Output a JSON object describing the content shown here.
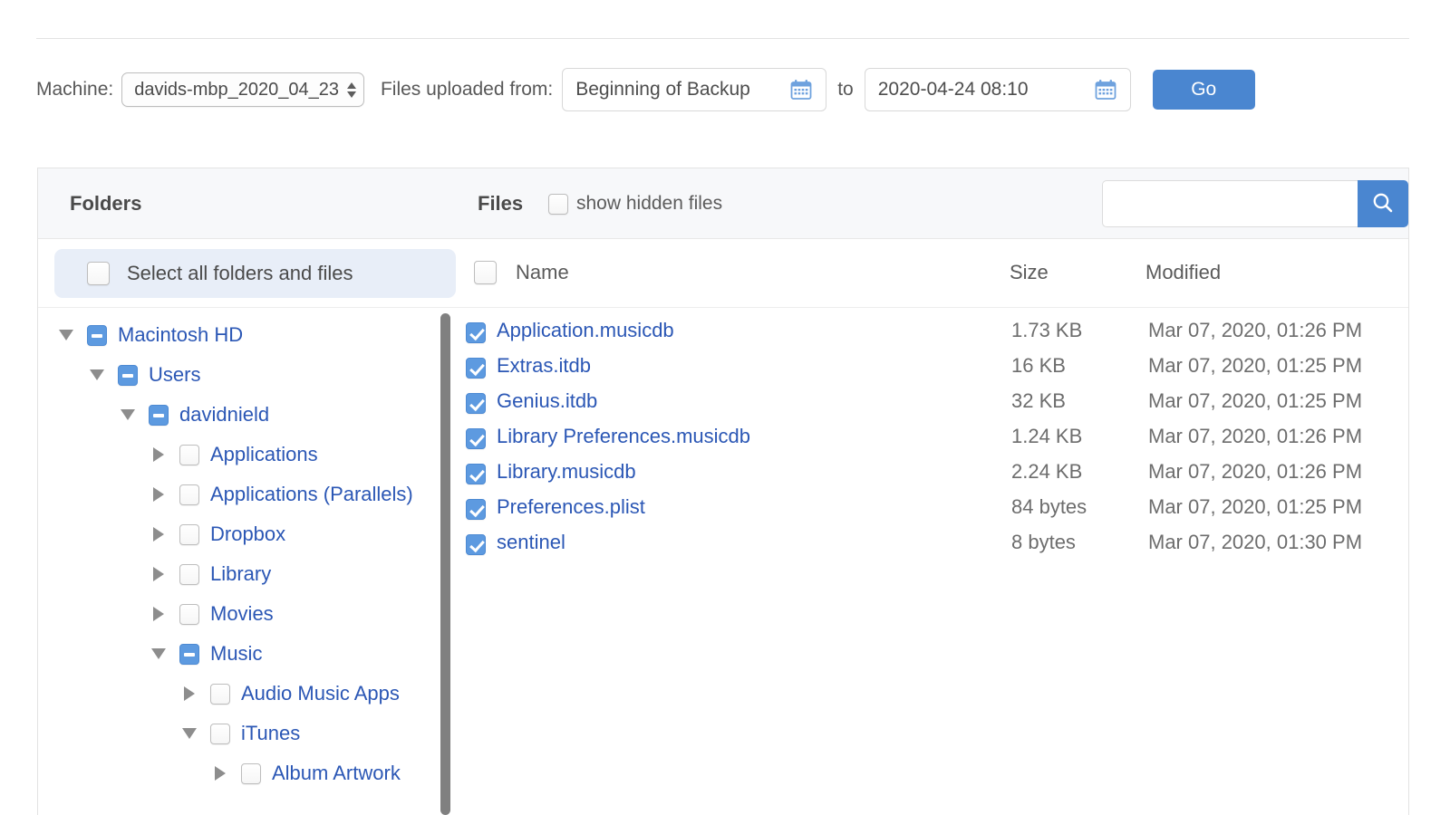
{
  "toolbar": {
    "machine_label": "Machine:",
    "machine_value": "davids-mbp_2020_04_23",
    "files_from_label": "Files uploaded from:",
    "date_from": "Beginning of Backup",
    "to_label": "to",
    "date_to": "2020-04-24 08:10",
    "go_label": "Go"
  },
  "panel": {
    "folders_title": "Folders",
    "files_title": "Files",
    "show_hidden_label": "show hidden files",
    "show_hidden_checked": false,
    "search_value": "",
    "search_placeholder": ""
  },
  "subhead": {
    "select_all_label": "Select all folders and files",
    "select_all_checked": false,
    "name_header": "Name",
    "name_header_checked": false,
    "size_header": "Size",
    "modified_header": "Modified"
  },
  "tree": {
    "nodes": [
      {
        "label": "Macintosh HD",
        "depth": 0,
        "arrow": "down",
        "check": "indeterminate"
      },
      {
        "label": "Users",
        "depth": 1,
        "arrow": "down",
        "check": "indeterminate"
      },
      {
        "label": "davidnield",
        "depth": 2,
        "arrow": "down",
        "check": "indeterminate"
      },
      {
        "label": "Applications",
        "depth": 3,
        "arrow": "right",
        "check": "unchecked"
      },
      {
        "label": "Applications (Parallels)",
        "depth": 3,
        "arrow": "right",
        "check": "unchecked"
      },
      {
        "label": "Dropbox",
        "depth": 3,
        "arrow": "right",
        "check": "unchecked"
      },
      {
        "label": "Library",
        "depth": 3,
        "arrow": "right",
        "check": "unchecked"
      },
      {
        "label": "Movies",
        "depth": 3,
        "arrow": "right",
        "check": "unchecked"
      },
      {
        "label": "Music",
        "depth": 3,
        "arrow": "down",
        "check": "indeterminate"
      },
      {
        "label": "Audio Music Apps",
        "depth": 4,
        "arrow": "right",
        "check": "unchecked"
      },
      {
        "label": "iTunes",
        "depth": 4,
        "arrow": "down",
        "check": "unchecked"
      },
      {
        "label": "Album Artwork",
        "depth": 5,
        "arrow": "right",
        "check": "unchecked"
      }
    ]
  },
  "files": {
    "rows": [
      {
        "name": "Application.musicdb",
        "size": "1.73 KB",
        "modified": "Mar 07, 2020, 01:26 PM",
        "checked": true
      },
      {
        "name": "Extras.itdb",
        "size": "16 KB",
        "modified": "Mar 07, 2020, 01:25 PM",
        "checked": true
      },
      {
        "name": "Genius.itdb",
        "size": "32 KB",
        "modified": "Mar 07, 2020, 01:25 PM",
        "checked": true
      },
      {
        "name": "Library Preferences.musicdb",
        "size": "1.24 KB",
        "modified": "Mar 07, 2020, 01:26 PM",
        "checked": true
      },
      {
        "name": "Library.musicdb",
        "size": "2.24 KB",
        "modified": "Mar 07, 2020, 01:26 PM",
        "checked": true
      },
      {
        "name": "Preferences.plist",
        "size": "84 bytes",
        "modified": "Mar 07, 2020, 01:25 PM",
        "checked": true
      },
      {
        "name": "sentinel",
        "size": "8 bytes",
        "modified": "Mar 07, 2020, 01:30 PM",
        "checked": true
      }
    ]
  },
  "icons": {
    "calendar_from": "calendar-icon",
    "calendar_to": "calendar-icon",
    "search": "search-icon",
    "stepper": "stepper-arrows-icon"
  },
  "colors": {
    "accent_blue": "#4a86d0",
    "link_blue": "#2b57b5",
    "checkbox_blue": "#5d9ae0",
    "select_all_bg": "#e8eef8",
    "panel_head_bg": "#f7f8fa"
  }
}
